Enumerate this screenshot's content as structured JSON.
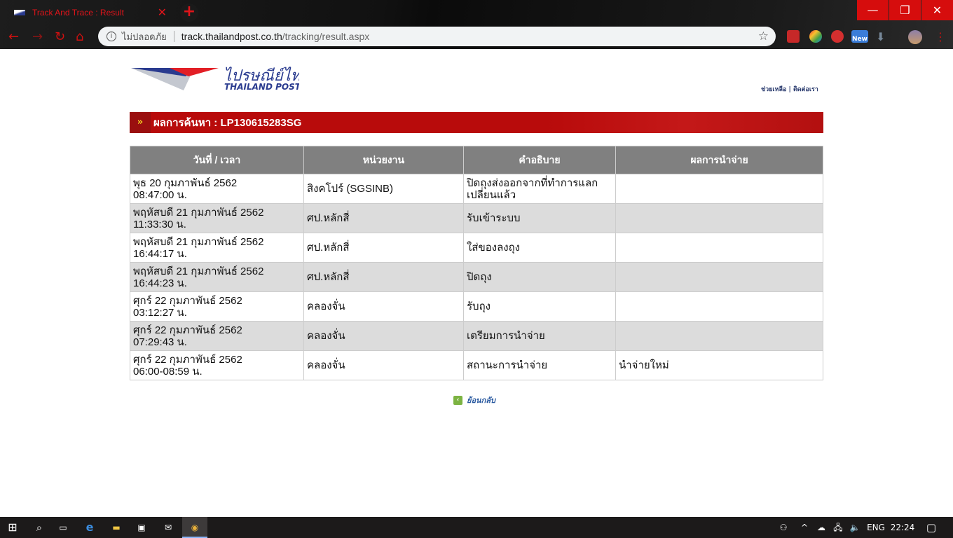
{
  "browser": {
    "tab_title": "Track And Trace : Result",
    "security_label": "ไม่ปลอดภัย",
    "url_host": "track.thailandpost.co.th",
    "url_path": "/tracking/result.aspx",
    "ext_new_badge": "New"
  },
  "header": {
    "logo_text_th": "ไปรษณีย์ไทย",
    "logo_text_en": "THAILAND POST",
    "links": [
      "ช่วยเหลือ",
      "ติดต่อเรา"
    ]
  },
  "banner": {
    "title": "ผลการค้นหา : LP130615283SG"
  },
  "table": {
    "columns": [
      "วันที่ / เวลา",
      "หน่วยงาน",
      "คำอธิบาย",
      "ผลการนำจ่าย"
    ],
    "rows": [
      {
        "date": "พุธ 20 กุมภาพันธ์ 2562",
        "time": "08:47:00 น.",
        "office": "สิงคโปร์ (SGSINB)",
        "desc": "ปิดถุงส่งออกจากที่ทำการแลกเปลี่ยนแล้ว",
        "result": ""
      },
      {
        "date": "พฤหัสบดี 21 กุมภาพันธ์ 2562",
        "time": "11:33:30 น.",
        "office": "ศป.หลักสี่",
        "desc": "รับเข้าระบบ",
        "result": ""
      },
      {
        "date": "พฤหัสบดี 21 กุมภาพันธ์ 2562",
        "time": "16:44:17 น.",
        "office": "ศป.หลักสี่",
        "desc": "ใส่ของลงถุง",
        "result": ""
      },
      {
        "date": "พฤหัสบดี 21 กุมภาพันธ์ 2562",
        "time": "16:44:23 น.",
        "office": "ศป.หลักสี่",
        "desc": "ปิดถุง",
        "result": ""
      },
      {
        "date": "ศุกร์ 22 กุมภาพันธ์ 2562",
        "time": "03:12:27 น.",
        "office": "คลองจั่น",
        "desc": "รับถุง",
        "result": ""
      },
      {
        "date": "ศุกร์ 22 กุมภาพันธ์ 2562",
        "time": "07:29:43 น.",
        "office": "คลองจั่น",
        "desc": "เตรียมการนำจ่าย",
        "result": ""
      },
      {
        "date": "ศุกร์ 22 กุมภาพันธ์ 2562",
        "time": "06:00-08:59 น.",
        "office": "คลองจั่น",
        "desc": "สถานะการนำจ่าย",
        "result": "นำจ่ายใหม่"
      }
    ]
  },
  "back_link": "ย้อนกลับ",
  "taskbar": {
    "lang": "ENG",
    "time": "22:24"
  },
  "colors": {
    "brand_red": "#b80b0b",
    "header_gray": "#808080",
    "alt_row": "#dcdcdc"
  }
}
